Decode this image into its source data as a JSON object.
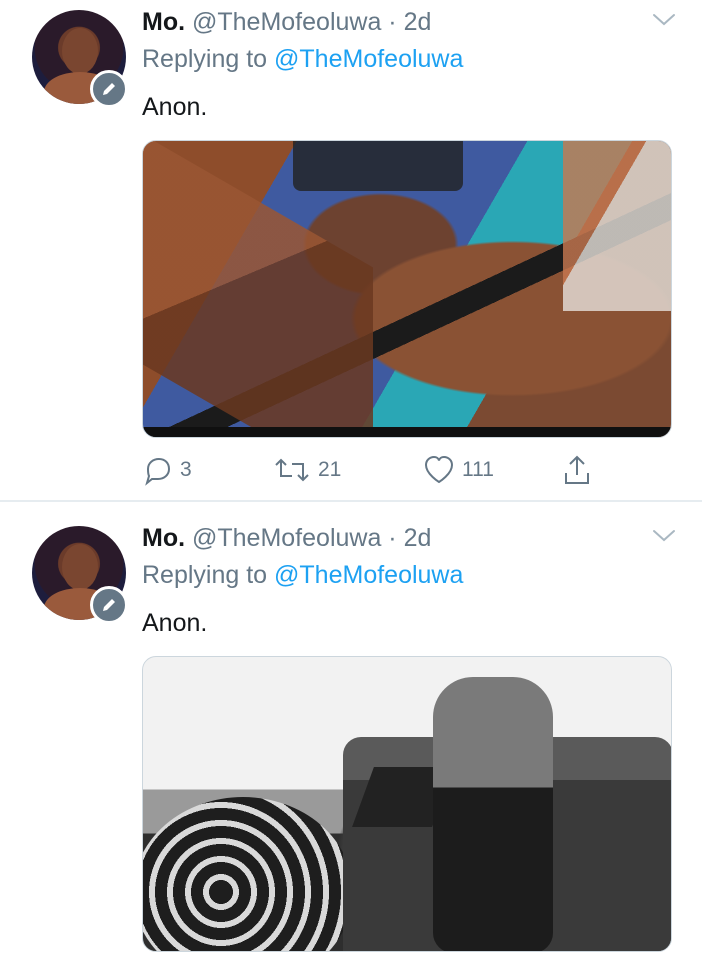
{
  "tweets": [
    {
      "name": "Mo.",
      "handle_time": "@TheMofeoluwa · 2d",
      "replying_prefix": "Replying to",
      "replying_mention": "@TheMofeoluwa",
      "text": "Anon.",
      "media_icon": "photo",
      "actions": {
        "reply_count": "3",
        "retweet_count": "21",
        "like_count": "111"
      }
    },
    {
      "name": "Mo.",
      "handle_time": "@TheMofeoluwa · 2d",
      "replying_prefix": "Replying to",
      "replying_mention": "@TheMofeoluwa",
      "text": "Anon.",
      "media_icon": "photo"
    }
  ],
  "colors": {
    "text_primary": "#14171a",
    "text_secondary": "#657786",
    "link": "#1da1f2",
    "divider": "#e6ecf0"
  },
  "icons": {
    "reply": "reply-icon",
    "retweet": "retweet-icon",
    "like": "like-icon",
    "share": "share-icon",
    "menu": "chevron-down-icon",
    "verified_style_badge": "edit-pencil-icon"
  }
}
